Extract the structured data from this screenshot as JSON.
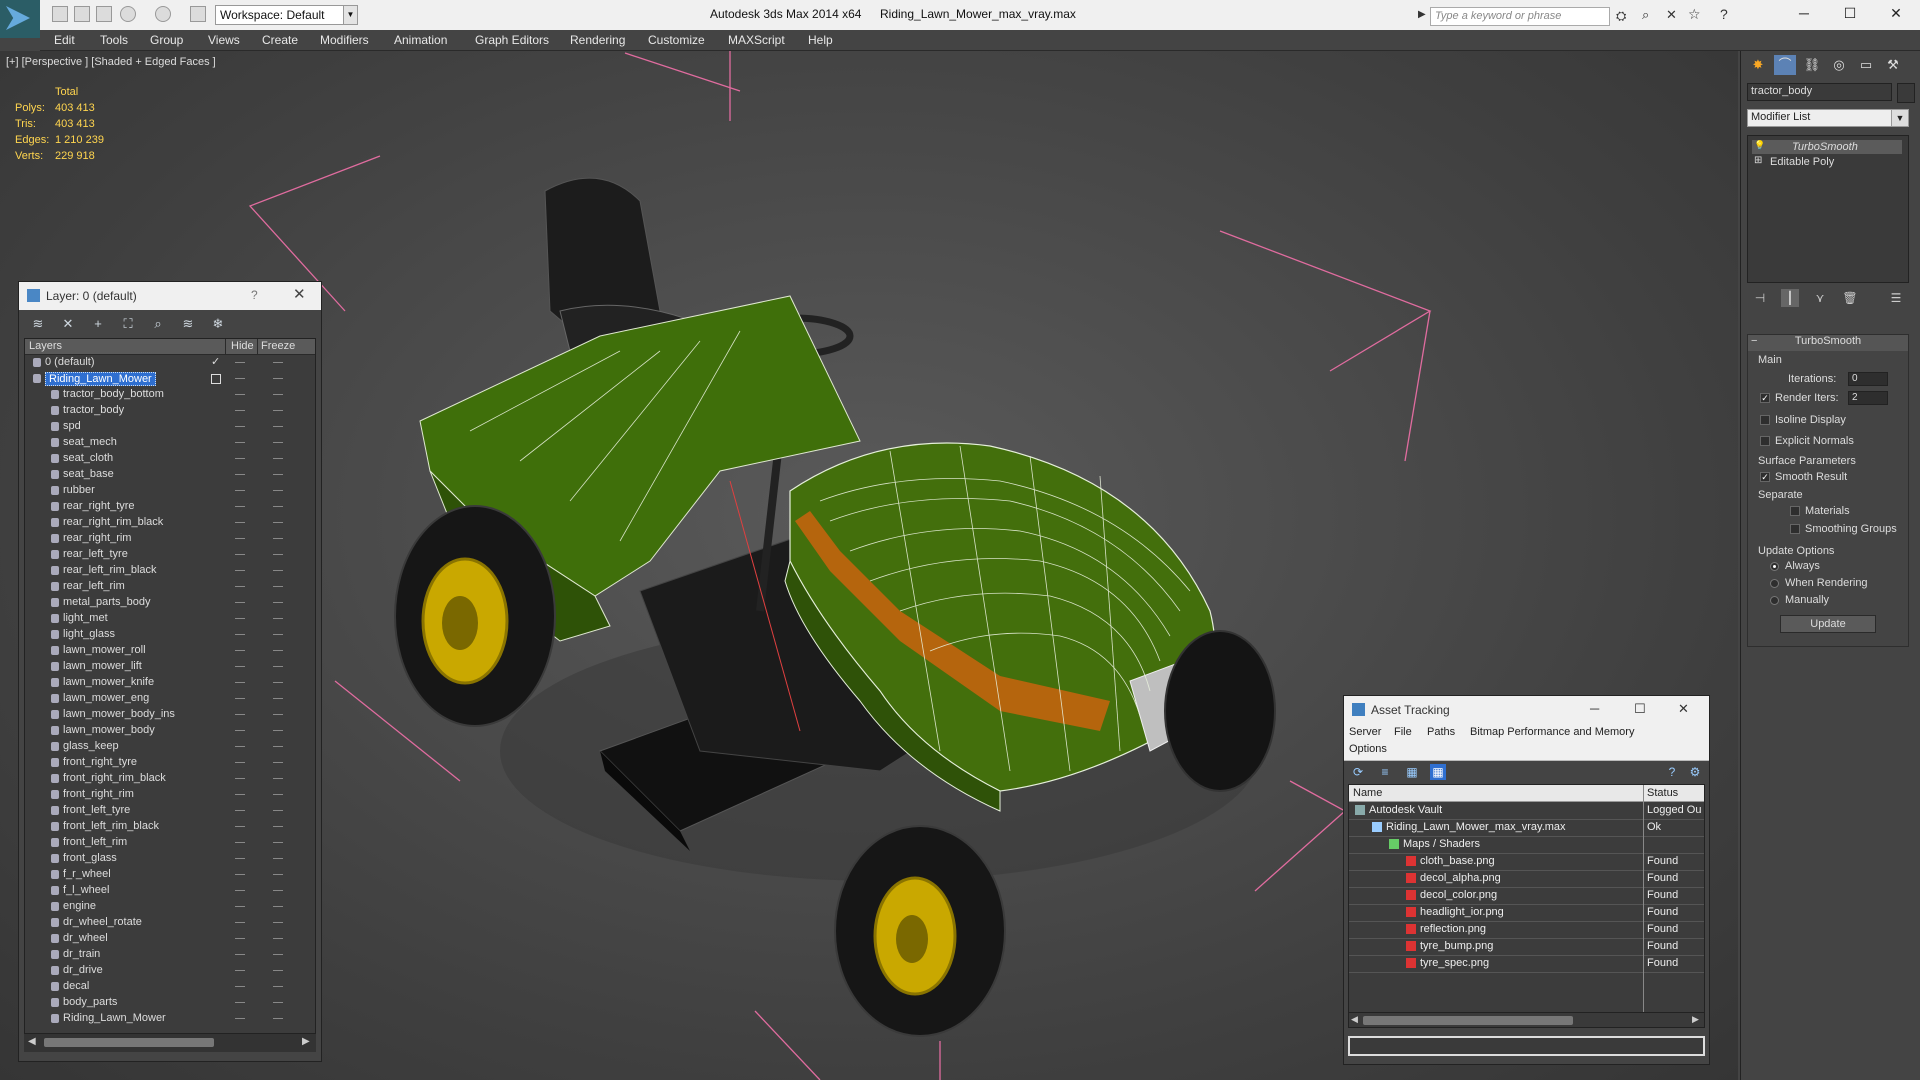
{
  "titlebar": {
    "workspace": "Workspace: Default",
    "app_title": "Autodesk 3ds Max  2014 x64",
    "file_title": "Riding_Lawn_Mower_max_vray.max",
    "search_placeholder": "Type a keyword or phrase"
  },
  "menu": [
    "Edit",
    "Tools",
    "Group",
    "Views",
    "Create",
    "Modifiers",
    "Animation",
    "Graph Editors",
    "Rendering",
    "Customize",
    "MAXScript",
    "Help"
  ],
  "viewport": {
    "label": "[+] [Perspective ] [Shaded + Edged Faces ]",
    "stats": {
      "total_label": "Total",
      "rows": [
        {
          "label": "Polys:",
          "value": "403 413"
        },
        {
          "label": "Tris:",
          "value": "403 413"
        },
        {
          "label": "Edges:",
          "value": "1 210 239"
        },
        {
          "label": "Verts:",
          "value": "229 918"
        }
      ]
    }
  },
  "layer_panel": {
    "title": "Layer: 0 (default)",
    "help": "?",
    "columns": {
      "layers": "Layers",
      "hide": "Hide",
      "freeze": "Freeze"
    },
    "layers": [
      {
        "name": "0 (default)",
        "level": 0,
        "type": "layer",
        "current": true
      },
      {
        "name": "Riding_Lawn_Mower",
        "level": 0,
        "type": "layer",
        "selected": true
      },
      {
        "name": "tractor_body_bottom",
        "level": 1
      },
      {
        "name": "tractor_body",
        "level": 1
      },
      {
        "name": "spd",
        "level": 1
      },
      {
        "name": "seat_mech",
        "level": 1
      },
      {
        "name": "seat_cloth",
        "level": 1
      },
      {
        "name": "seat_base",
        "level": 1
      },
      {
        "name": "rubber",
        "level": 1
      },
      {
        "name": "rear_right_tyre",
        "level": 1
      },
      {
        "name": "rear_right_rim_black",
        "level": 1
      },
      {
        "name": "rear_right_rim",
        "level": 1
      },
      {
        "name": "rear_left_tyre",
        "level": 1
      },
      {
        "name": "rear_left_rim_black",
        "level": 1
      },
      {
        "name": "rear_left_rim",
        "level": 1
      },
      {
        "name": "metal_parts_body",
        "level": 1
      },
      {
        "name": "light_met",
        "level": 1
      },
      {
        "name": "light_glass",
        "level": 1
      },
      {
        "name": "lawn_mower_roll",
        "level": 1
      },
      {
        "name": "lawn_mower_lift",
        "level": 1
      },
      {
        "name": "lawn_mower_knife",
        "level": 1
      },
      {
        "name": "lawn_mower_eng",
        "level": 1
      },
      {
        "name": "lawn_mower_body_ins",
        "level": 1
      },
      {
        "name": "lawn_mower_body",
        "level": 1
      },
      {
        "name": "glass_keep",
        "level": 1
      },
      {
        "name": "front_right_tyre",
        "level": 1
      },
      {
        "name": "front_right_rim_black",
        "level": 1
      },
      {
        "name": "front_right_rim",
        "level": 1
      },
      {
        "name": "front_left_tyre",
        "level": 1
      },
      {
        "name": "front_left_rim_black",
        "level": 1
      },
      {
        "name": "front_left_rim",
        "level": 1
      },
      {
        "name": "front_glass",
        "level": 1
      },
      {
        "name": "f_r_wheel",
        "level": 1
      },
      {
        "name": "f_l_wheel",
        "level": 1
      },
      {
        "name": "engine",
        "level": 1
      },
      {
        "name": "dr_wheel_rotate",
        "level": 1
      },
      {
        "name": "dr_wheel",
        "level": 1
      },
      {
        "name": "dr_train",
        "level": 1
      },
      {
        "name": "dr_drive",
        "level": 1
      },
      {
        "name": "decal",
        "level": 1
      },
      {
        "name": "body_parts",
        "level": 1
      },
      {
        "name": "Riding_Lawn_Mower",
        "level": 1
      }
    ]
  },
  "command_panel": {
    "object_name": "tractor_body",
    "modifier_list": "Modifier List",
    "stack": [
      {
        "name": "TurboSmooth",
        "active": true
      },
      {
        "name": "Editable Poly",
        "active": false
      }
    ],
    "turbosmooth": {
      "title": "TurboSmooth",
      "main": "Main",
      "iterations_label": "Iterations:",
      "iterations_value": "0",
      "render_iters_label": "Render Iters:",
      "render_iters_value": "2",
      "render_iters_checked": true,
      "isoline": "Isoline Display",
      "explicit_normals": "Explicit Normals",
      "surface_params": "Surface Parameters",
      "smooth_result": "Smooth Result",
      "separate": "Separate",
      "materials": "Materials",
      "smoothing_groups": "Smoothing Groups",
      "update_options": "Update Options",
      "always": "Always",
      "when_rendering": "When Rendering",
      "manually": "Manually",
      "update_button": "Update"
    }
  },
  "asset_tracking": {
    "title": "Asset Tracking",
    "menu": [
      "Server",
      "File",
      "Paths",
      "Bitmap Performance and Memory",
      "Options"
    ],
    "columns": {
      "name": "Name",
      "status": "Status"
    },
    "rows": [
      {
        "name": "Autodesk Vault",
        "status": "Logged Ou",
        "level": 0,
        "icon": "vault"
      },
      {
        "name": "Riding_Lawn_Mower_max_vray.max",
        "status": "Ok",
        "level": 1,
        "icon": "max"
      },
      {
        "name": "Maps / Shaders",
        "status": "",
        "level": 2,
        "icon": "maps"
      },
      {
        "name": "cloth_base.png",
        "status": "Found",
        "level": 3,
        "icon": "png"
      },
      {
        "name": "decol_alpha.png",
        "status": "Found",
        "level": 3,
        "icon": "png"
      },
      {
        "name": "decol_color.png",
        "status": "Found",
        "level": 3,
        "icon": "png"
      },
      {
        "name": "headlight_ior.png",
        "status": "Found",
        "level": 3,
        "icon": "png"
      },
      {
        "name": "reflection.png",
        "status": "Found",
        "level": 3,
        "icon": "png"
      },
      {
        "name": "tyre_bump.png",
        "status": "Found",
        "level": 3,
        "icon": "png"
      },
      {
        "name": "tyre_spec.png",
        "status": "Found",
        "level": 3,
        "icon": "png"
      }
    ]
  },
  "colors": {
    "accent": "#2f6fd0",
    "stat_text": "#ffd54f",
    "mower_green": "#3f6f0a",
    "wheel_yellow": "#c9a800"
  }
}
